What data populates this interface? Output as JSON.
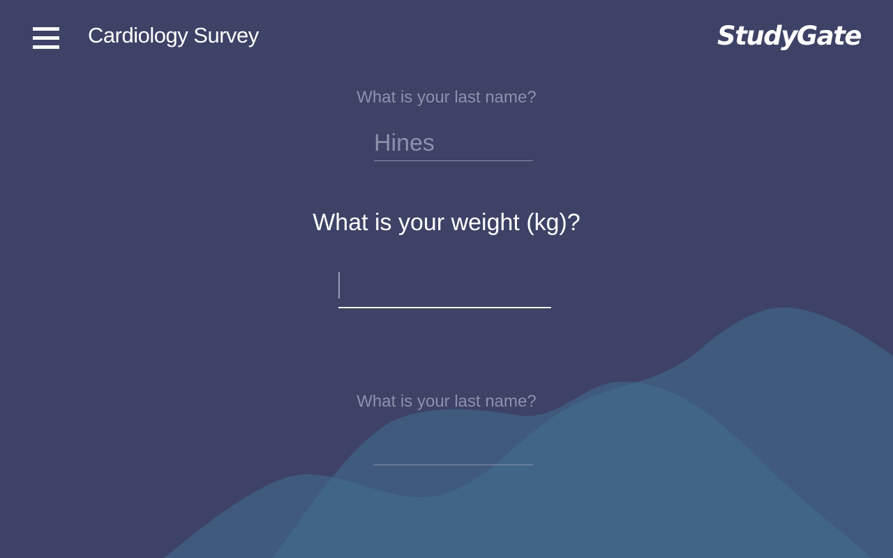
{
  "header": {
    "menu_icon": "hamburger-menu-icon",
    "title": "Cardiology Survey",
    "logo_text": "StudyGate"
  },
  "survey": {
    "previous_question": {
      "label": "What is your last name?",
      "value": "Hines"
    },
    "current_question": {
      "label": "What is your weight (kg)?",
      "value": ""
    },
    "next_question": {
      "label": "What is your last name?",
      "value": ""
    }
  },
  "colors": {
    "background": "#3d4266",
    "wave": "#427090",
    "active_text": "#ffffff",
    "dim_text": "#8d91ad"
  }
}
